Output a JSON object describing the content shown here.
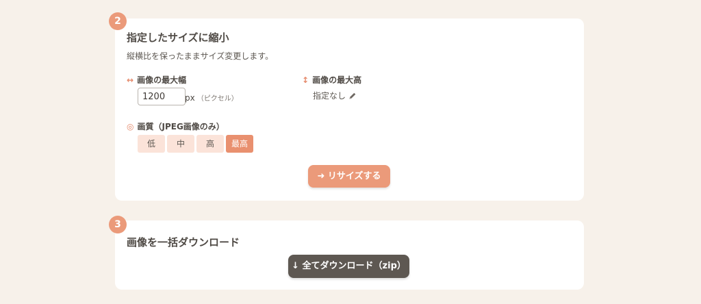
{
  "theme": {
    "background": "#f7f1ea",
    "accent": "#eb9a7a",
    "accent_active": "#e9906f",
    "accent_light": "#fbe3d9",
    "dark_button": "#5e5852",
    "text": "#4f4a45"
  },
  "step2": {
    "badge": "2",
    "title": "指定したサイズに縮小",
    "description": "縦横比を保ったままサイズ変更します。",
    "max_width": {
      "icon": "horizontal-arrows-icon",
      "icon_glyph": "↔",
      "label": "画像の最大幅",
      "value": "1200",
      "unit": "px",
      "unit_note": "（ピクセル）"
    },
    "max_height": {
      "icon": "vertical-arrows-icon",
      "icon_glyph": "↕",
      "label": "画像の最大高",
      "value": "指定なし",
      "edit_icon": "pencil-icon"
    },
    "quality": {
      "icon": "target-circle-icon",
      "icon_glyph": "◎",
      "label": "画質（JPEG画像のみ）",
      "options": [
        "低",
        "中",
        "高",
        "最高"
      ],
      "selected": "最高"
    },
    "resize_button": "➜ リサイズする"
  },
  "step3": {
    "badge": "3",
    "title": "画像を一括ダウンロード",
    "download_button": "↓ 全てダウンロード（zip）"
  }
}
